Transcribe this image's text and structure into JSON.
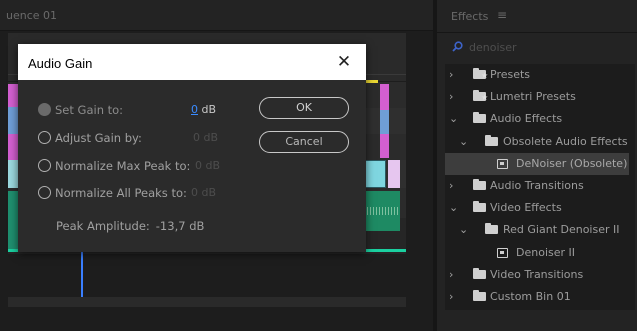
{
  "timeline": {
    "sequence_tab": "uence 01"
  },
  "dialog": {
    "title": "Audio Gain",
    "close_glyph": "✕",
    "options": [
      {
        "label": "Set Gain to:",
        "value_num": "0",
        "value_unit": " dB",
        "selected": true
      },
      {
        "label": "Adjust Gain by:",
        "value": "0 dB",
        "selected": false
      },
      {
        "label": "Normalize Max Peak to:",
        "value": "0 dB",
        "selected": false
      },
      {
        "label": "Normalize All Peaks to:",
        "value": "0 dB",
        "selected": false
      }
    ],
    "ok_label": "OK",
    "cancel_label": "Cancel",
    "peak_label": "Peak Amplitude:",
    "peak_value": "-13,7 dB"
  },
  "effects": {
    "title": "Effects",
    "menu_glyph": "≡",
    "search_value": "denoiser",
    "tree": [
      {
        "label": "Presets",
        "icon": "preset-folder-icon",
        "chevron": "›",
        "depth": 0
      },
      {
        "label": "Lumetri Presets",
        "icon": "preset-folder-icon",
        "chevron": "›",
        "depth": 0
      },
      {
        "label": "Audio Effects",
        "icon": "folder-icon",
        "chevron": "⌄",
        "depth": 0
      },
      {
        "label": "Obsolete Audio Effects",
        "icon": "folder-icon",
        "chevron": "⌄",
        "depth": 1
      },
      {
        "label": "DeNoiser (Obsolete)",
        "icon": "effect-icon",
        "chevron": "",
        "depth": 2,
        "selected": true
      },
      {
        "label": "Audio Transitions",
        "icon": "folder-icon",
        "chevron": "›",
        "depth": 0
      },
      {
        "label": "Video Effects",
        "icon": "folder-icon",
        "chevron": "⌄",
        "depth": 0
      },
      {
        "label": "Red Giant Denoiser II",
        "icon": "folder-icon",
        "chevron": "⌄",
        "depth": 1
      },
      {
        "label": "Denoiser II",
        "icon": "effect-icon",
        "chevron": "",
        "depth": 2
      },
      {
        "label": "Video Transitions",
        "icon": "folder-icon",
        "chevron": "›",
        "depth": 0
      },
      {
        "label": "Custom Bin 01",
        "icon": "folder-icon",
        "chevron": "›",
        "depth": 0
      }
    ]
  },
  "colors": {
    "playhead": "#3a7fff",
    "audio_line": "#1bd0a0",
    "clip_magenta": "#d35fd0",
    "clip_blue": "#6f9ed6",
    "clip_cyan": "#7fd6e0",
    "accent_value": "#3a8bff"
  }
}
